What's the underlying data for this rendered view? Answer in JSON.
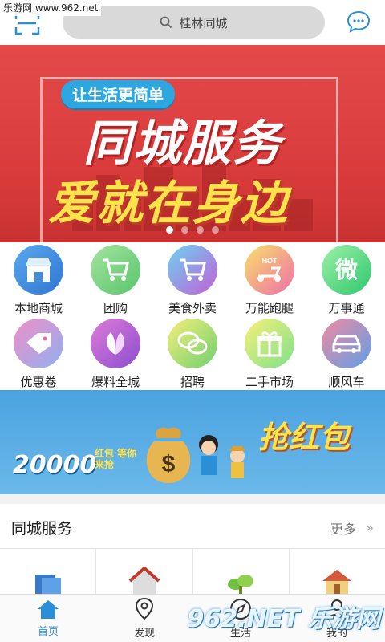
{
  "watermark_top": "乐游网 www.962.net",
  "header": {
    "search_placeholder": "桂林同城"
  },
  "banner": {
    "pill": "让生活更简单",
    "slogan_line1": "同城服务",
    "slogan_line2": "爱就在身边",
    "slide_count": 4,
    "active_slide": 1
  },
  "categories": [
    {
      "label": "本地商城",
      "icon": "store-icon",
      "color": "#3f8ee0"
    },
    {
      "label": "团购",
      "icon": "shopping-cart-icon",
      "color": "#7ad17a"
    },
    {
      "label": "美食外卖",
      "icon": "food-cart-icon",
      "color": "#c95fd8"
    },
    {
      "label": "万能跑腿",
      "icon": "scooter-hot-icon",
      "color": "#f06fa0"
    },
    {
      "label": "万事通",
      "icon": "wei-icon",
      "color": "#3fd07a"
    },
    {
      "label": "优惠卷",
      "icon": "coupon-tag-icon",
      "color": "#e76fb6"
    },
    {
      "label": "爆料全城",
      "icon": "leaves-icon",
      "color": "#b05fd0"
    },
    {
      "label": "招聘",
      "icon": "chat-bubbles-icon",
      "color": "#6fd06a"
    },
    {
      "label": "二手市场",
      "icon": "gift-box-icon",
      "color": "#9fe07a"
    },
    {
      "label": "顺风车",
      "icon": "car-icon",
      "color": "#5fa0e8"
    }
  ],
  "promo": {
    "amount": "20000",
    "sub": "红包 等你来抢",
    "title": "抢红包"
  },
  "section": {
    "title": "同城服务",
    "more": "更多"
  },
  "tabs": [
    {
      "label": "首页",
      "icon": "home-icon",
      "active": true
    },
    {
      "label": "发现",
      "icon": "location-icon",
      "active": false
    },
    {
      "label": "生活",
      "icon": "compass-icon",
      "active": false
    },
    {
      "label": "我的",
      "icon": "user-icon",
      "active": false
    }
  ],
  "watermark_br": "962.NET 乐游网"
}
